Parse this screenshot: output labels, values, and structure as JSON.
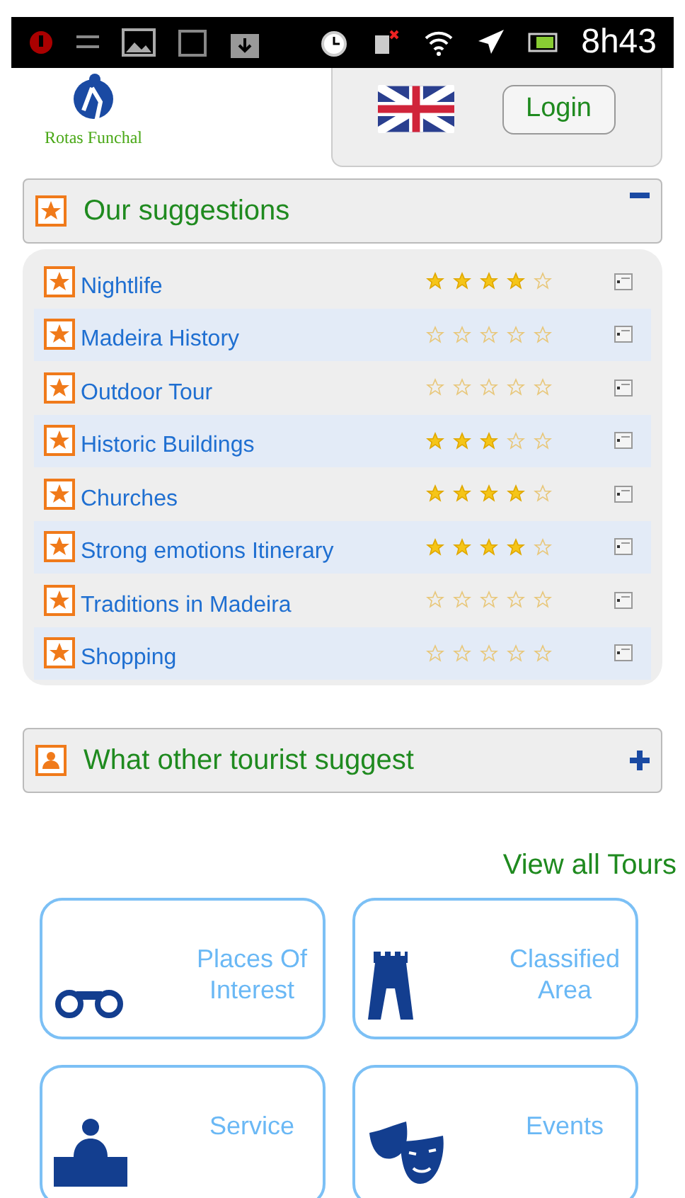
{
  "status_bar": {
    "time": "8h43"
  },
  "header": {
    "logo_text": "Rotas Funchal",
    "login": "Login"
  },
  "sections": [
    {
      "title": "Our suggestions",
      "expanded": true,
      "items": [
        {
          "label": "Nightlife",
          "stars": 4
        },
        {
          "label": "Madeira History",
          "stars": 0
        },
        {
          "label": "Outdoor Tour",
          "stars": 0
        },
        {
          "label": "Historic Buildings",
          "stars": 3
        },
        {
          "label": "Churches",
          "stars": 4
        },
        {
          "label": "Strong emotions Itinerary",
          "stars": 4
        },
        {
          "label": "Traditions in Madeira",
          "stars": 0
        },
        {
          "label": "Shopping",
          "stars": 0
        }
      ]
    },
    {
      "title": "What other tourist suggest",
      "expanded": false
    }
  ],
  "view_all": "View all Tours",
  "tiles": [
    {
      "label": "Places Of Interest",
      "kind": "binoculars"
    },
    {
      "label": "Classified Area",
      "kind": "tower"
    },
    {
      "label": "Service",
      "kind": "service"
    },
    {
      "label": "Events",
      "kind": "masks"
    }
  ]
}
